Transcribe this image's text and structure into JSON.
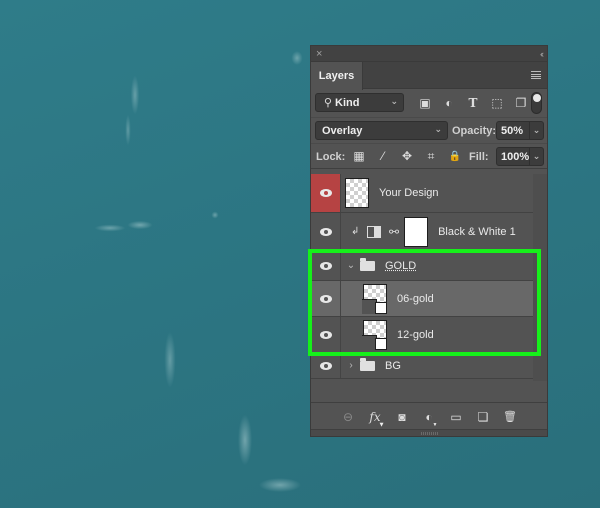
{
  "panel": {
    "close_glyph": "×",
    "collapse_glyph": "‹‹",
    "tab_label": "Layers"
  },
  "filter": {
    "kind_label": "Kind",
    "icons": [
      "pixel-layer-filter-icon",
      "adjustment-layer-filter-icon",
      "type-layer-filter-icon",
      "shape-layer-filter-icon",
      "smart-object-filter-icon"
    ],
    "icon_glyphs": [
      "▣",
      "◐",
      "T",
      "⬚",
      "❐"
    ]
  },
  "blend": {
    "mode": "Overlay",
    "opacity_label": "Opacity:",
    "opacity_value": "50%"
  },
  "lock": {
    "label": "Lock:",
    "icon_glyphs": [
      "▦",
      "⁄",
      "✥",
      "⌗",
      "🔒"
    ],
    "fill_label": "Fill:",
    "fill_value": "100%"
  },
  "layers": [
    {
      "name": "Your Design",
      "type": "pixel",
      "visible": true,
      "eye_highlighted": true
    },
    {
      "name": "Black & White 1",
      "type": "adjustment",
      "visible": true,
      "clipped": true
    },
    {
      "name": "GOLD",
      "type": "group",
      "visible": true,
      "expanded": true
    },
    {
      "name": "06-gold",
      "type": "smart-object",
      "visible": true,
      "selected": true,
      "indent": 1
    },
    {
      "name": "12-gold",
      "type": "smart-object",
      "visible": true,
      "indent": 1
    },
    {
      "name": "BG",
      "type": "group",
      "visible": true,
      "expanded": false
    }
  ],
  "glyphs": {
    "chevron_down": "⌄",
    "chevron_right": "›",
    "clip_arrow": "↲",
    "chain": "∞",
    "dropdown": "⌄"
  },
  "footer": {
    "icon_glyphs": [
      "⊖",
      "fx",
      "◙",
      "◐",
      "▭",
      "❏",
      "🗑"
    ]
  },
  "highlight_color": "#16f01a"
}
